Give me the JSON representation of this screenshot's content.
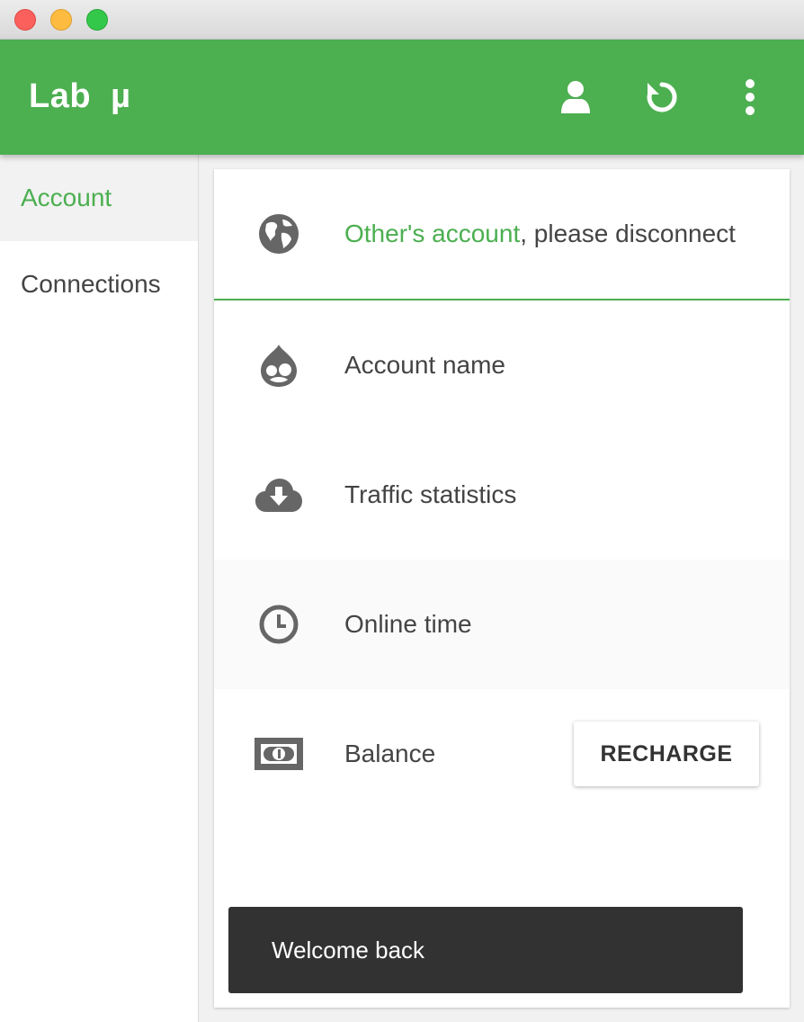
{
  "window": {
    "controls": [
      "close",
      "minimize",
      "zoom"
    ]
  },
  "appbar": {
    "title": "Lab  µ",
    "actions": [
      {
        "icon": "user-icon"
      },
      {
        "icon": "refresh-icon"
      },
      {
        "icon": "more-vert-icon"
      }
    ],
    "color": "#4caf50"
  },
  "sidebar": {
    "items": [
      {
        "label": "Account",
        "active": true
      },
      {
        "label": "Connections",
        "active": false
      }
    ]
  },
  "account": {
    "status": {
      "highlight": "Other's account",
      "rest": ", please disconnect",
      "icon": "globe-icon"
    },
    "rows": [
      {
        "label": "Account name",
        "icon": "drupal-icon"
      },
      {
        "label": "Traffic statistics",
        "icon": "cloud-download-icon"
      },
      {
        "label": "Online time",
        "icon": "clock-icon"
      },
      {
        "label": "Balance",
        "icon": "money-icon"
      }
    ],
    "recharge_label": "RECHARGE"
  },
  "snackbar": {
    "message": "Welcome back"
  }
}
